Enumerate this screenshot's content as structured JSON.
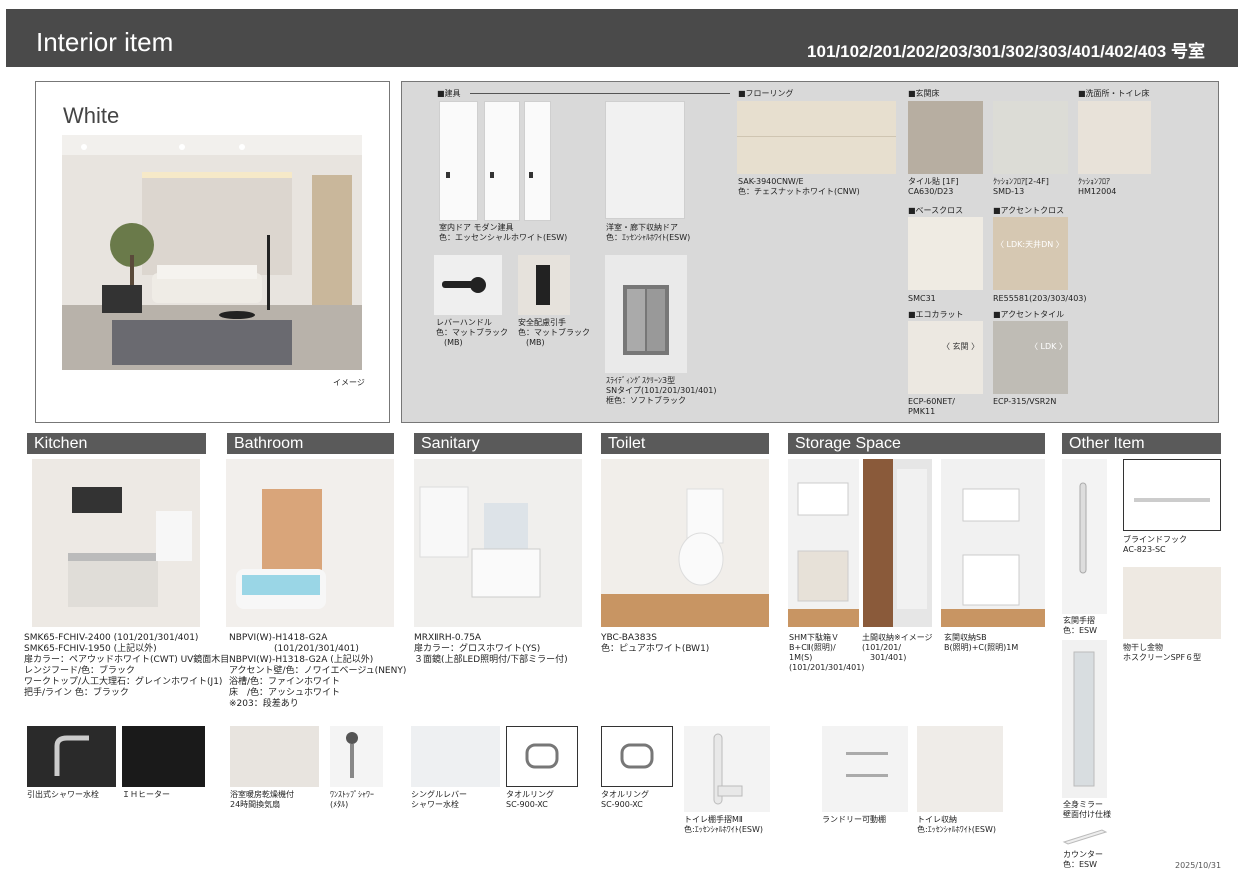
{
  "header": {
    "title": "Interior item",
    "units": "101/102/201/202/203/301/302/303/401/402/403 号室"
  },
  "hero": {
    "color_name": "White",
    "caption": "イメージ"
  },
  "panel": {
    "tategu_label": "■建具",
    "doors_caption": "室内ドア モダン建具\n色：エッセンシャルホワイト(ESW)",
    "storage_door_caption": "洋室・廊下収納ドア\n色：ｴｯｾﾝｼｬﾙﾎﾜｲﾄ(ESW)",
    "lever_caption": "レバーハンドル\n色：マットブラック\n　(MB)",
    "pull_caption": "安全配慮引手\n色：マットブラック\n　(MB)",
    "sliding_caption": "ｽﾗｲﾃﾞｨﾝｸﾞｽｸﾘｰﾝ3型\nSNタイプ(101/201/301/401)\n框色：ソフトブラック",
    "flooring_label": "■フローリング",
    "flooring_caption": "SAK-3940CNW/E\n色：チェスナットホワイト(CNW)",
    "genkan_label": "■玄関床",
    "tile_caption": "タイル貼 [1F]\nCA630/D23",
    "cushion_caption": "ｸｯｼｮﾝﾌﾛｱ[2-4F]\nSMD-13",
    "washroom_label": "■洗面所・トイレ床",
    "washroom_caption": "ｸｯｼｮﾝﾌﾛｱ\nHM12004",
    "base_label": "■ベースクロス",
    "base_caption": "SMC31",
    "accent_cloth_label": "■アクセントクロス",
    "accent_cloth_tag": "〈 LDK:天井DN 〉",
    "accent_cloth_caption": "RE55581(203/303/403)",
    "eco_label": "■エコカラット",
    "eco_tag": "〈 玄関 〉",
    "eco_caption": "ECP-60NET/\nPMK11",
    "accent_tile_label": "■アクセントタイル",
    "accent_tile_tag": "〈 LDK 〉",
    "accent_tile_caption": "ECP-315/VSR2N"
  },
  "sections": {
    "kitchen": "Kitchen",
    "bathroom": "Bathroom",
    "sanitary": "Sanitary",
    "toilet": "Toilet",
    "storage": "Storage Space",
    "other": "Other  Item"
  },
  "kitchen": {
    "spec": "SMK65-FCHIV-2400 (101/201/301/401)\nSMK65-FCHIV-1950 (上記以外)\n扉カラー：ペアウッドホワイト(CWT) UV鏡面木目\nレンジフード/色：ブラック\nワークトップ/人工大理石：グレインホワイト(J1)\n把手/ライン 色：ブラック",
    "faucet": "引出式シャワー水栓",
    "ih": "ＩＨヒーター"
  },
  "bathroom": {
    "spec": "NBPVI(W)-H1418-G2A\n　　　　　(101/201/301/401)\nNBPVI(W)-H1318-G2A (上記以外)\nアクセント壁/色：ノワイエベージュ(NENY)\n浴槽/色：ファインホワイト\n床　/色：アッシュホワイト\n※203：段差あり",
    "dryer": "浴室暖房乾燥機付\n24時間換気扇",
    "shower": "ﾜﾝｽﾄｯﾌﾟｼｬﾜｰ\n(ﾒﾀﾙ)"
  },
  "sanitary": {
    "spec": "MRXⅡRH-0.75A\n扉カラー：グロスホワイト(YS)\n３面鏡(上部LED照明付/下部ミラー付)",
    "lever": "シングルレバー\nシャワー水栓",
    "ring": "タオルリング\nSC-900-XC"
  },
  "toilet": {
    "spec": "YBC-BA383S\n色：ピュアホワイト(BW1)",
    "ring": "タオルリング\nSC-900-XC",
    "shelf": "トイレ棚手摺MⅡ\n色:ｴｯｾﾝｼｬﾙﾎﾜｲﾄ(ESW)"
  },
  "storage": {
    "shoe": "SHM下駄箱Ｖ\nB+CⅡ(照明)/\n1M(S)\n(101/201/301/401)",
    "earth": "土間収納※イメージ\n(101/201/\n　301/401)",
    "entry": "玄関収納SB\nB(照明)+C(照明)1M",
    "laundry": "ランドリー可動棚",
    "toilet_storage": "トイレ収納\n色:ｴｯｾﾝｼｬﾙﾎﾜｲﾄ(ESW)"
  },
  "other": {
    "handrail": "玄関手摺\n色：ESW",
    "blind_hook": "ブラインドフック\nAC-823-SC",
    "drying": "物干し金物\nホスクリーンSPF６型",
    "mirror": "全身ミラー\n壁面付け仕様",
    "counter": "カウンター\n色：ESW"
  },
  "footer": {
    "date": "2025/10/31"
  }
}
